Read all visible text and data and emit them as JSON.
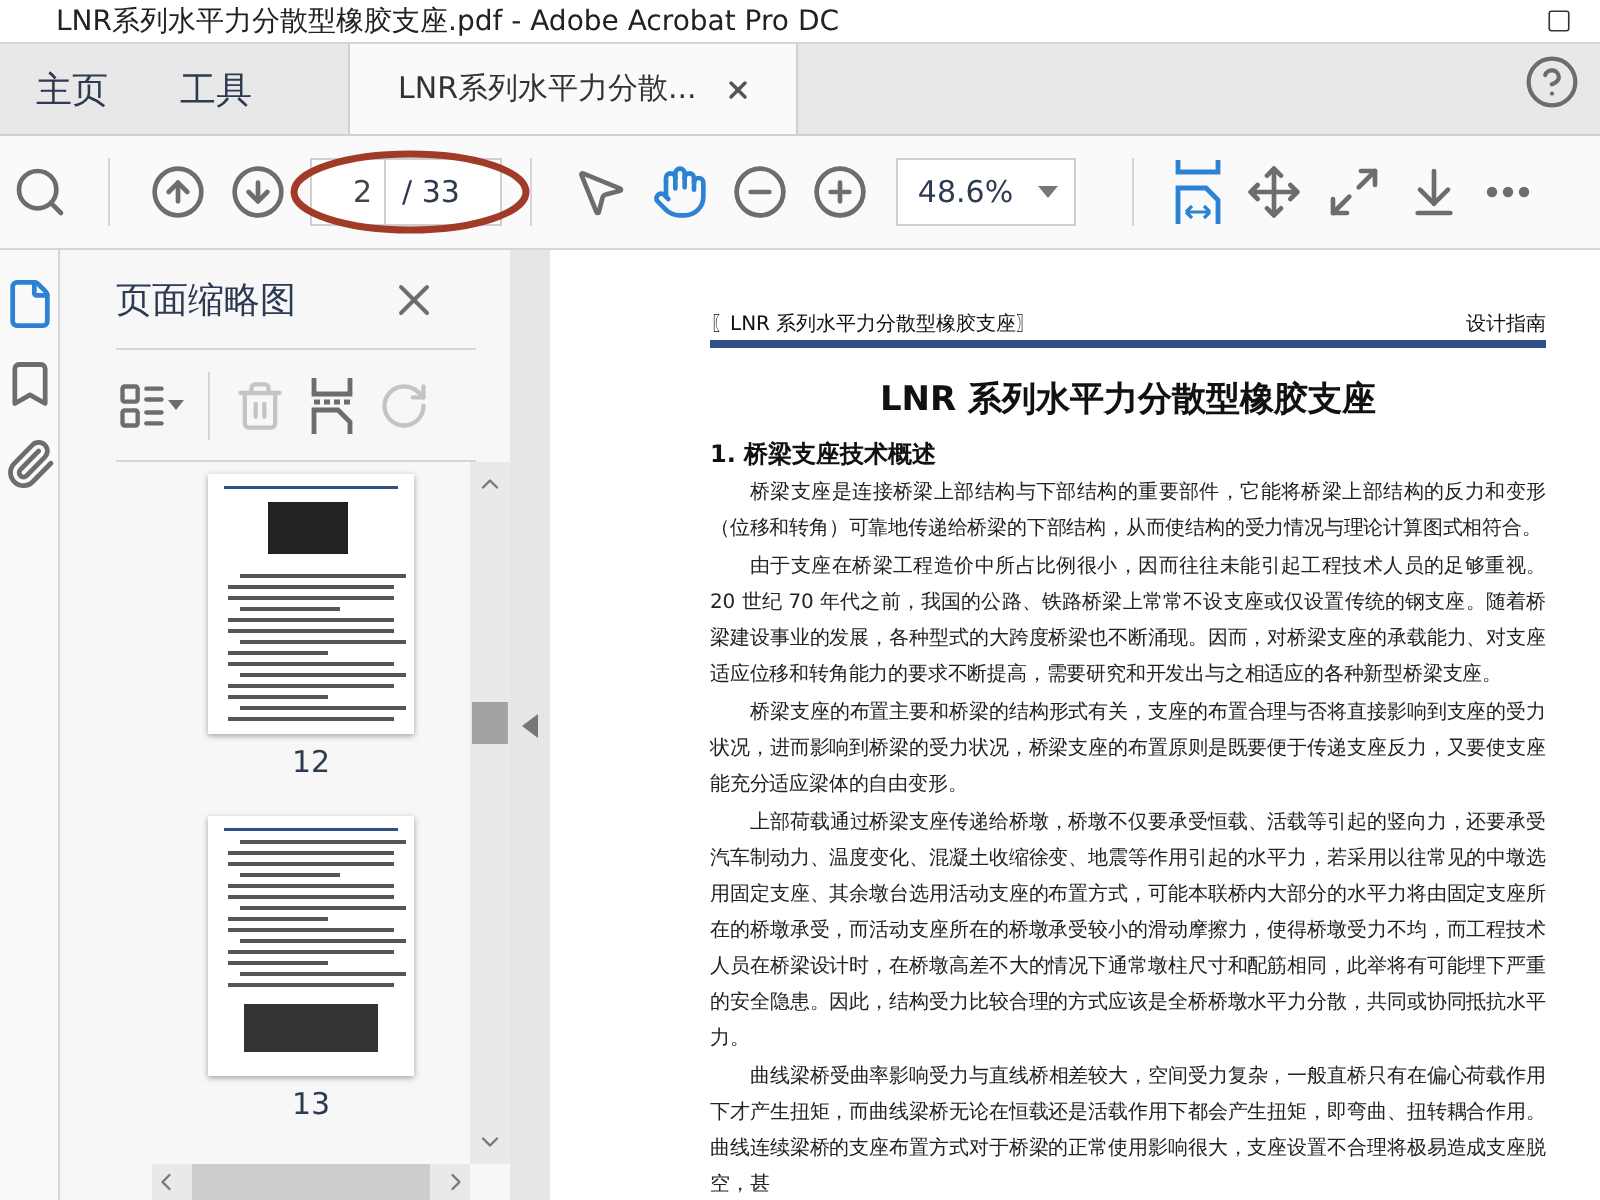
{
  "window": {
    "title": "LNR系列水平力分散型橡胶支座.pdf - Adobe Acrobat Pro DC"
  },
  "tabs": [
    {
      "label": "主页",
      "kind": "nav",
      "selected": false
    },
    {
      "label": "工具",
      "kind": "nav",
      "selected": false
    },
    {
      "label": "LNR系列水平力分散...",
      "kind": "document",
      "selected": true
    }
  ],
  "toolbar": {
    "page_current": "2",
    "page_total": "/ 33",
    "zoom": "48.6%",
    "tools": [
      {
        "kind": "search",
        "selected": false
      },
      {
        "kind": "separator"
      },
      {
        "kind": "prev",
        "selected": false
      },
      {
        "kind": "next",
        "selected": false
      },
      {
        "kind": "page"
      },
      {
        "kind": "separator"
      },
      {
        "kind": "select",
        "selected": false
      },
      {
        "kind": "hand",
        "selected": true
      },
      {
        "kind": "zoom-out",
        "selected": false
      },
      {
        "kind": "zoom-in",
        "selected": false
      },
      {
        "kind": "zoom"
      },
      {
        "kind": "separator"
      },
      {
        "kind": "fit-width",
        "selected": true
      },
      {
        "kind": "fit-page",
        "selected": false
      },
      {
        "kind": "full-screen",
        "selected": false
      },
      {
        "kind": "scroll-mode",
        "selected": false
      },
      {
        "kind": "more",
        "selected": false
      }
    ]
  },
  "sidebar_rail": [
    {
      "kind": "pages",
      "selected": true
    },
    {
      "kind": "bookmarks",
      "selected": false
    },
    {
      "kind": "attachments",
      "selected": false
    }
  ],
  "thumbnails_panel": {
    "title": "页面缩略图",
    "tools": [
      {
        "kind": "options",
        "disabled": false
      },
      {
        "kind": "delete",
        "disabled": true
      },
      {
        "kind": "insert",
        "disabled": false
      },
      {
        "kind": "rotate",
        "disabled": true
      }
    ],
    "pages": [
      {
        "label": "12",
        "kind": "figure"
      },
      {
        "label": "13",
        "kind": "table"
      }
    ]
  },
  "document": {
    "header_left": "〖LNR 系列水平力分散型橡胶支座〗",
    "header_right": "设计指南",
    "title": "LNR 系列水平力分散型橡胶支座",
    "heading": "1. 桥梁支座技术概述",
    "paragraphs": [
      "桥梁支座是连接桥梁上部结构与下部结构的重要部件，它能将桥梁上部结构的反力和变形（位移和转角）可靠地传递给桥梁的下部结构，从而使结构的受力情况与理论计算图式相符合。",
      "由于支座在桥梁工程造价中所占比例很小，因而往往未能引起工程技术人员的足够重视。20 世纪 70 年代之前，我国的公路、铁路桥梁上常常不设支座或仅设置传统的钢支座。随着桥梁建设事业的发展，各种型式的大跨度桥梁也不断涌现。因而，对桥梁支座的承载能力、对支座适应位移和转角能力的要求不断提高，需要研究和开发出与之相适应的各种新型桥梁支座。",
      "桥梁支座的布置主要和桥梁的结构形式有关，支座的布置合理与否将直接影响到支座的受力状况，进而影响到桥梁的受力状况，桥梁支座的布置原则是既要便于传递支座反力，又要使支座能充分适应梁体的自由变形。",
      "上部荷载通过桥梁支座传递给桥墩，桥墩不仅要承受恒载、活载等引起的竖向力，还要承受汽车制动力、温度变化、混凝土收缩徐变、地震等作用引起的水平力，若采用以往常见的中墩选用固定支座、其余墩台选用活动支座的布置方式，可能本联桥内大部分的水平力将由固定支座所在的桥墩承受，而活动支座所在的桥墩承受较小的滑动摩擦力，使得桥墩受力不均，而工程技术人员在桥梁设计时，在桥墩高差不大的情况下通常墩柱尺寸和配筋相同，此举将有可能埋下严重的安全隐患。因此，结构受力比较合理的方式应该是全桥桥墩水平力分散，共同或协同抵抗水平力。",
      "曲线梁桥受曲率影响受力与直线桥相差较大，空间受力复杂，一般直桥只有在偏心荷载作用下才产生扭矩，而曲线梁桥无论在恒载还是活载作用下都会产生扭矩，即弯曲、扭转耦合作用。曲线连续梁桥的支座布置方式对于桥梁的正常使用影响很大，支座设置不合理将极易造成支座脱空，甚"
    ]
  }
}
